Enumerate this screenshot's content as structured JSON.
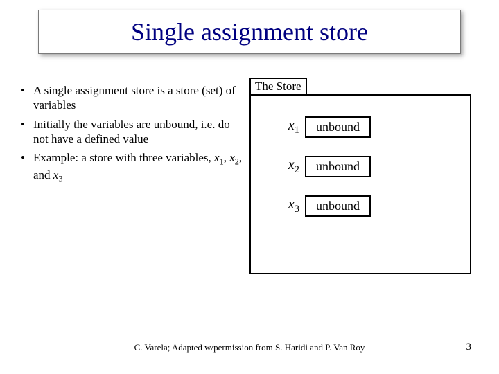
{
  "title": "Single assignment store",
  "bullets": [
    {
      "pre": "A single assignment store is a store (set) of variables"
    },
    {
      "pre": "Initially the variables are unbound, i.e. do not have a defined value"
    },
    {
      "pre": "Example: a store with three variables, ",
      "vars": "x1, x2, and x3",
      "vars_html": true
    }
  ],
  "store_label": "The Store",
  "vars": [
    {
      "name": "x",
      "sub": "1",
      "value": "unbound"
    },
    {
      "name": "x",
      "sub": "2",
      "value": "unbound"
    },
    {
      "name": "x",
      "sub": "3",
      "value": "unbound"
    }
  ],
  "footer": "C. Varela; Adapted w/permission from S. Haridi and P. Van Roy",
  "page": "3"
}
